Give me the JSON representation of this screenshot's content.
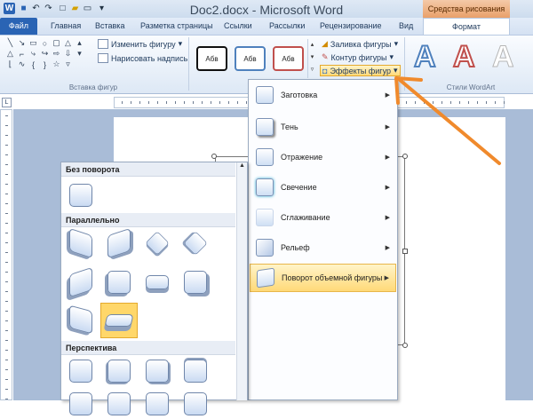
{
  "window": {
    "title": "Doc2.docx - Microsoft Word",
    "context_label": "Средства рисования"
  },
  "qat": [
    "W",
    "↶",
    "↷",
    "▾"
  ],
  "tabs": [
    {
      "label": "Файл"
    },
    {
      "label": "Главная"
    },
    {
      "label": "Вставка"
    },
    {
      "label": "Разметка страницы"
    },
    {
      "label": "Ссылки"
    },
    {
      "label": "Рассылки"
    },
    {
      "label": "Рецензирование"
    },
    {
      "label": "Вид"
    },
    {
      "label": "Формат"
    }
  ],
  "ribbon": {
    "insert_shapes_group": "Вставка фигур",
    "change_shape": "Изменить фигуру",
    "draw_textbox": "Нарисовать надпись",
    "style_boxes": [
      "Абв",
      "Абв",
      "Абв"
    ],
    "fill": "Заливка фигуры",
    "outline": "Контур фигуры",
    "effects": "Эффекты фигур",
    "wordart_group": "Стили WordArt",
    "wordart_letters": [
      "A",
      "A",
      "A"
    ],
    "colors": {
      "accent": "#2a64b4",
      "context": "#e9a06a",
      "highlight": "#ffd978",
      "arrow": "#f08a2c"
    }
  },
  "effects_menu": {
    "items": [
      {
        "label": "Заготовка"
      },
      {
        "label": "Тень"
      },
      {
        "label": "Отражение"
      },
      {
        "label": "Свечение"
      },
      {
        "label": "Сглаживание"
      },
      {
        "label": "Рельеф"
      },
      {
        "label": "Поворот объемной фигуры"
      }
    ]
  },
  "rotation_gallery": {
    "sections": [
      {
        "title": "Без поворота"
      },
      {
        "title": "Параллельно"
      },
      {
        "title": "Перспектива"
      }
    ]
  }
}
